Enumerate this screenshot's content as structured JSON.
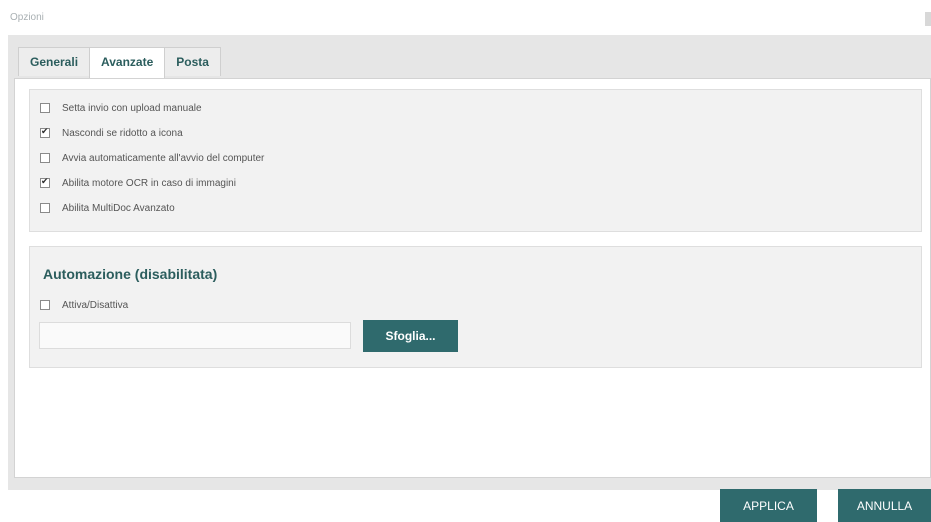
{
  "window": {
    "title": "Opzioni"
  },
  "tabs": [
    {
      "label": "Generali",
      "active": false
    },
    {
      "label": "Avanzate",
      "active": true
    },
    {
      "label": "Posta",
      "active": false
    }
  ],
  "options": [
    {
      "label": "Setta invio con upload manuale",
      "checked": false
    },
    {
      "label": "Nascondi se ridotto a icona",
      "checked": true
    },
    {
      "label": "Avvia automaticamente all'avvio del computer",
      "checked": false
    },
    {
      "label": "Abilita motore OCR in caso di immagini",
      "checked": true
    },
    {
      "label": "Abilita MultiDoc Avanzato",
      "checked": false
    }
  ],
  "automation": {
    "title": "Automazione (disabilitata)",
    "toggle_label": "Attiva/Disattiva",
    "toggle_checked": false,
    "path_value": "",
    "browse_label": "Sfoglia..."
  },
  "footer": {
    "apply_label": "APPLICA",
    "cancel_label": "ANNULLA"
  },
  "colors": {
    "accent": "#2f6a6d",
    "tab_text": "#2b5d5d"
  }
}
